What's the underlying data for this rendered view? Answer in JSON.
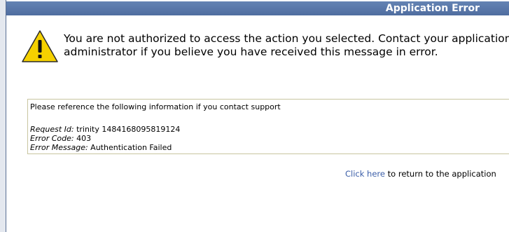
{
  "header": {
    "title": "Application Error"
  },
  "error": {
    "icon": "warning-icon",
    "message": "You are not authorized to access the action you selected. Contact your application administrator if you believe you have received this message in error."
  },
  "support": {
    "intro": "Please reference the following information if you contact support",
    "request_id_label": "Request Id:",
    "request_id_value": "trinity 1484168095819124",
    "error_code_label": "Error Code:",
    "error_code_value": "403",
    "error_message_label": "Error Message:",
    "error_message_value": "Authentication Failed"
  },
  "footer": {
    "link_text": "Click here",
    "suffix_text": "to return to the application"
  },
  "colors": {
    "header_bg": "#5874a6",
    "link": "#3b5ea8",
    "box_border": "#c8c5a0",
    "warning_fill": "#f5d100"
  }
}
